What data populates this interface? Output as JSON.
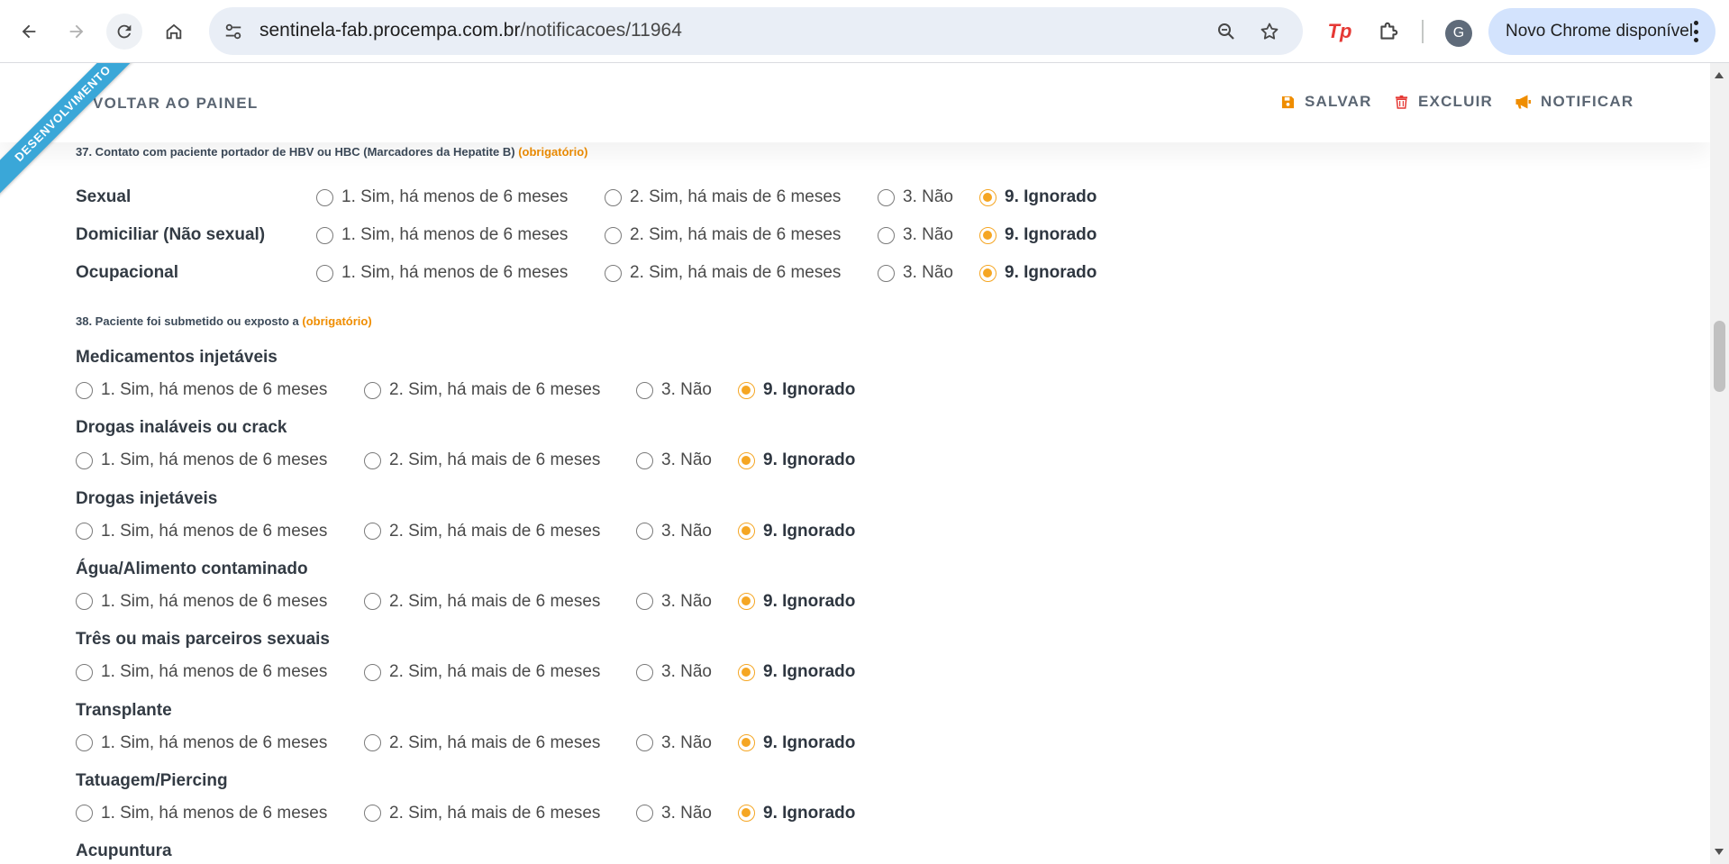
{
  "browser": {
    "url_host": "sentinela-fab.procempa.com.br",
    "url_path": "/notificacoes/11964",
    "update_label": "Novo Chrome disponível",
    "profile_initial": "G",
    "extension_label": "Tp",
    "icons": [
      "back-icon",
      "forward-icon",
      "reload-icon",
      "home-icon",
      "site-info-icon",
      "zoom-icon",
      "bookmark-star-icon",
      "extensions-puzzle-icon",
      "menu-dots-icon"
    ]
  },
  "ribbon": "DESENVOLVIMENTO",
  "toolbar": {
    "back_label": "VOLTAR AO PAINEL",
    "save_label": "SALVAR",
    "delete_label": "EXCLUIR",
    "notify_label": "NOTIFICAR"
  },
  "options": {
    "o1": "1. Sim, há menos de 6 meses",
    "o2": "2. Sim, há mais de 6 meses",
    "o3": "3. Não",
    "o9": "9. Ignorado"
  },
  "q37": {
    "title": "37. Contato com paciente portador de HBV ou HBC (Marcadores da Hepatite B)",
    "required": "(obrigatório)",
    "rows": [
      {
        "label": "Sexual",
        "selected": "9. Ignorado"
      },
      {
        "label": "Domiciliar (Não sexual)",
        "selected": "9. Ignorado"
      },
      {
        "label": "Ocupacional",
        "selected": "9. Ignorado"
      }
    ]
  },
  "q38": {
    "title": "38. Paciente foi submetido ou exposto a",
    "required": "(obrigatório)",
    "rows": [
      {
        "label": "Medicamentos injetáveis",
        "selected": "9. Ignorado"
      },
      {
        "label": "Drogas inaláveis ou crack",
        "selected": "9. Ignorado"
      },
      {
        "label": "Drogas injetáveis",
        "selected": "9. Ignorado"
      },
      {
        "label": "Água/Alimento contaminado",
        "selected": "9. Ignorado"
      },
      {
        "label": "Três ou mais parceiros sexuais",
        "selected": "9. Ignorado"
      },
      {
        "label": "Transplante",
        "selected": "9. Ignorado"
      },
      {
        "label": "Tatuagem/Piercing",
        "selected": "9. Ignorado"
      },
      {
        "label": "Acupuntura",
        "selected": ""
      }
    ]
  },
  "colors": {
    "accent": "#f5a623",
    "required": "#ef8d00",
    "ribbon": "#3aa7d8",
    "update_pill": "#d3e3fd"
  }
}
